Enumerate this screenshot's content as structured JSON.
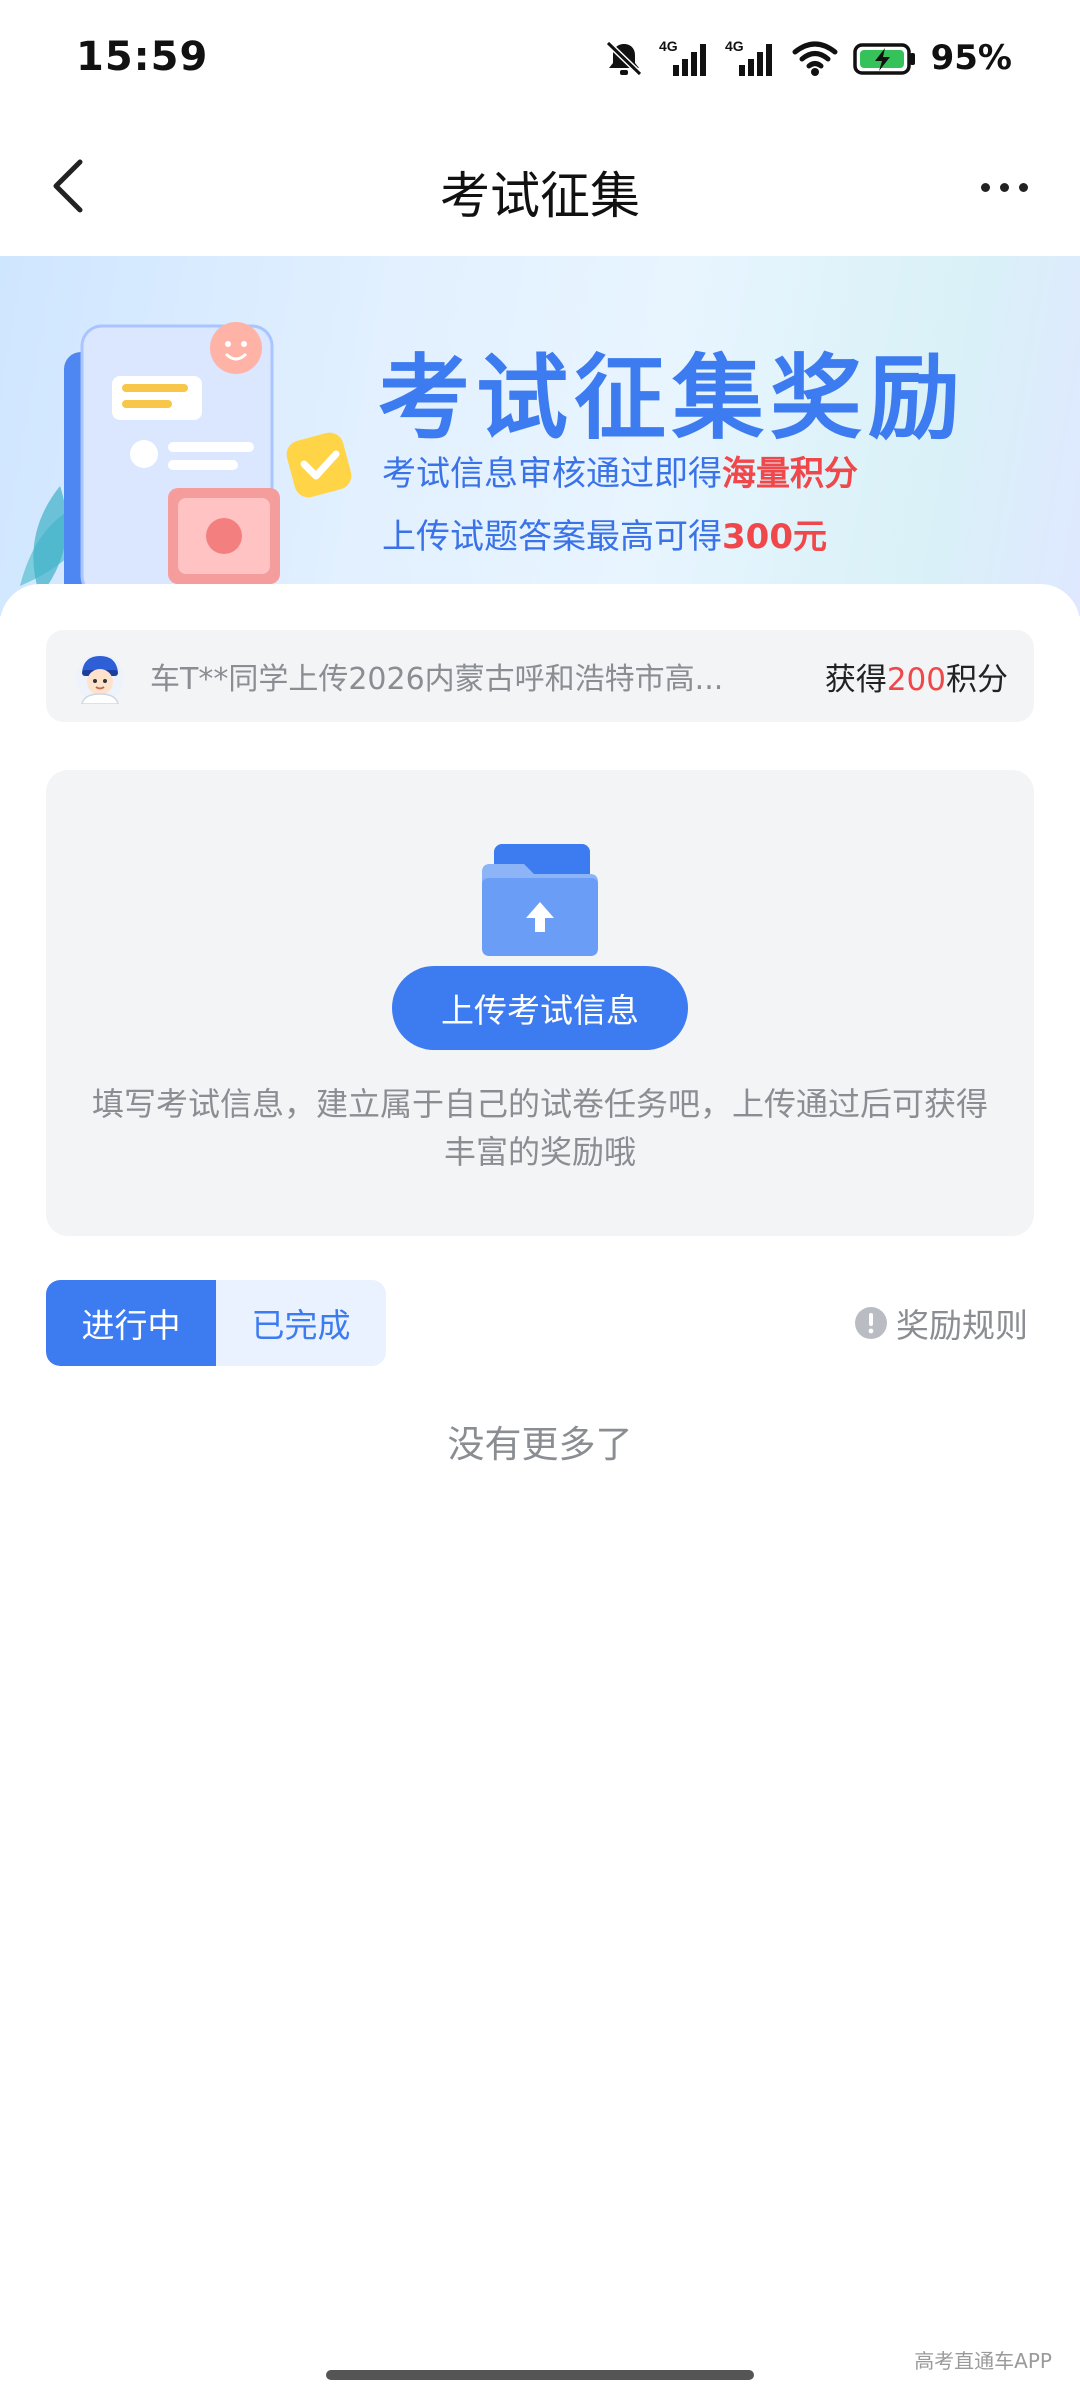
{
  "status_bar": {
    "time": "15:59",
    "battery": "95%",
    "icons": [
      "mute-icon",
      "4g-signal-icon",
      "4g-signal-icon",
      "wifi-icon",
      "battery-charging-icon"
    ]
  },
  "navbar": {
    "title": "考试征集",
    "back_icon": "chevron-left-icon",
    "more_icon": "more-horizontal-icon"
  },
  "banner": {
    "title": "考试征集奖励",
    "line1_prefix": "考试信息审核通过即得",
    "line1_highlight": "海量积分",
    "line2_prefix": "上传试题答案最高可得",
    "line2_highlight": "300元"
  },
  "ticker": {
    "text": "车T**同学上传2026内蒙古呼和浩特市高...",
    "reward_prefix": "获得",
    "reward_points": "200",
    "reward_suffix": "积分"
  },
  "upload": {
    "button_label": "上传考试信息",
    "description": "填写考试信息，建立属于自己的试卷任务吧，上传通过后可获得丰富的奖励哦"
  },
  "tabs": {
    "items": [
      {
        "label": "进行中",
        "active": true
      },
      {
        "label": "已完成",
        "active": false
      }
    ]
  },
  "rules": {
    "label": "奖励规则"
  },
  "list": {
    "empty_text": "没有更多了"
  },
  "watermark": "高考直通车APP",
  "colors": {
    "accent": "#3d7bf0",
    "highlight_red": "#f0474a",
    "muted_text": "#8a8d92",
    "card_bg": "#f3f4f6"
  }
}
